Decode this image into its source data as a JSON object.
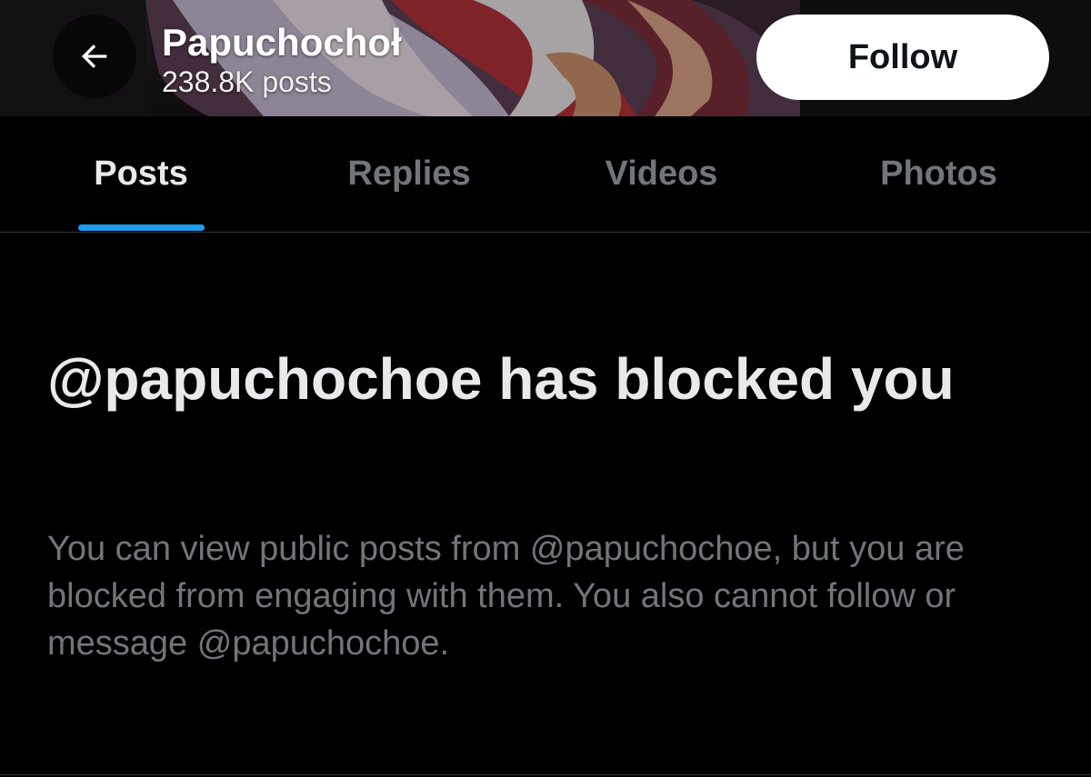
{
  "header": {
    "display_name": "Papuchochoł",
    "post_count": "238.8K posts",
    "follow_label": "Follow"
  },
  "tabs": [
    {
      "label": "Posts",
      "active": true
    },
    {
      "label": "Replies",
      "active": false
    },
    {
      "label": "Videos",
      "active": false
    },
    {
      "label": "Photos",
      "active": false
    }
  ],
  "blocked": {
    "title": "@papuchochoe has blocked you",
    "description": "You can view public posts from @papuchochoe, but you are blocked from engaging with them. You also cannot follow or message @papuchochoe."
  },
  "icons": {
    "back": "arrow-left-icon"
  },
  "colors": {
    "background": "#000000",
    "accent": "#1d9bf0",
    "text_primary": "#e7e9ea",
    "text_secondary": "#71767b",
    "follow_button_bg": "#ffffff"
  }
}
